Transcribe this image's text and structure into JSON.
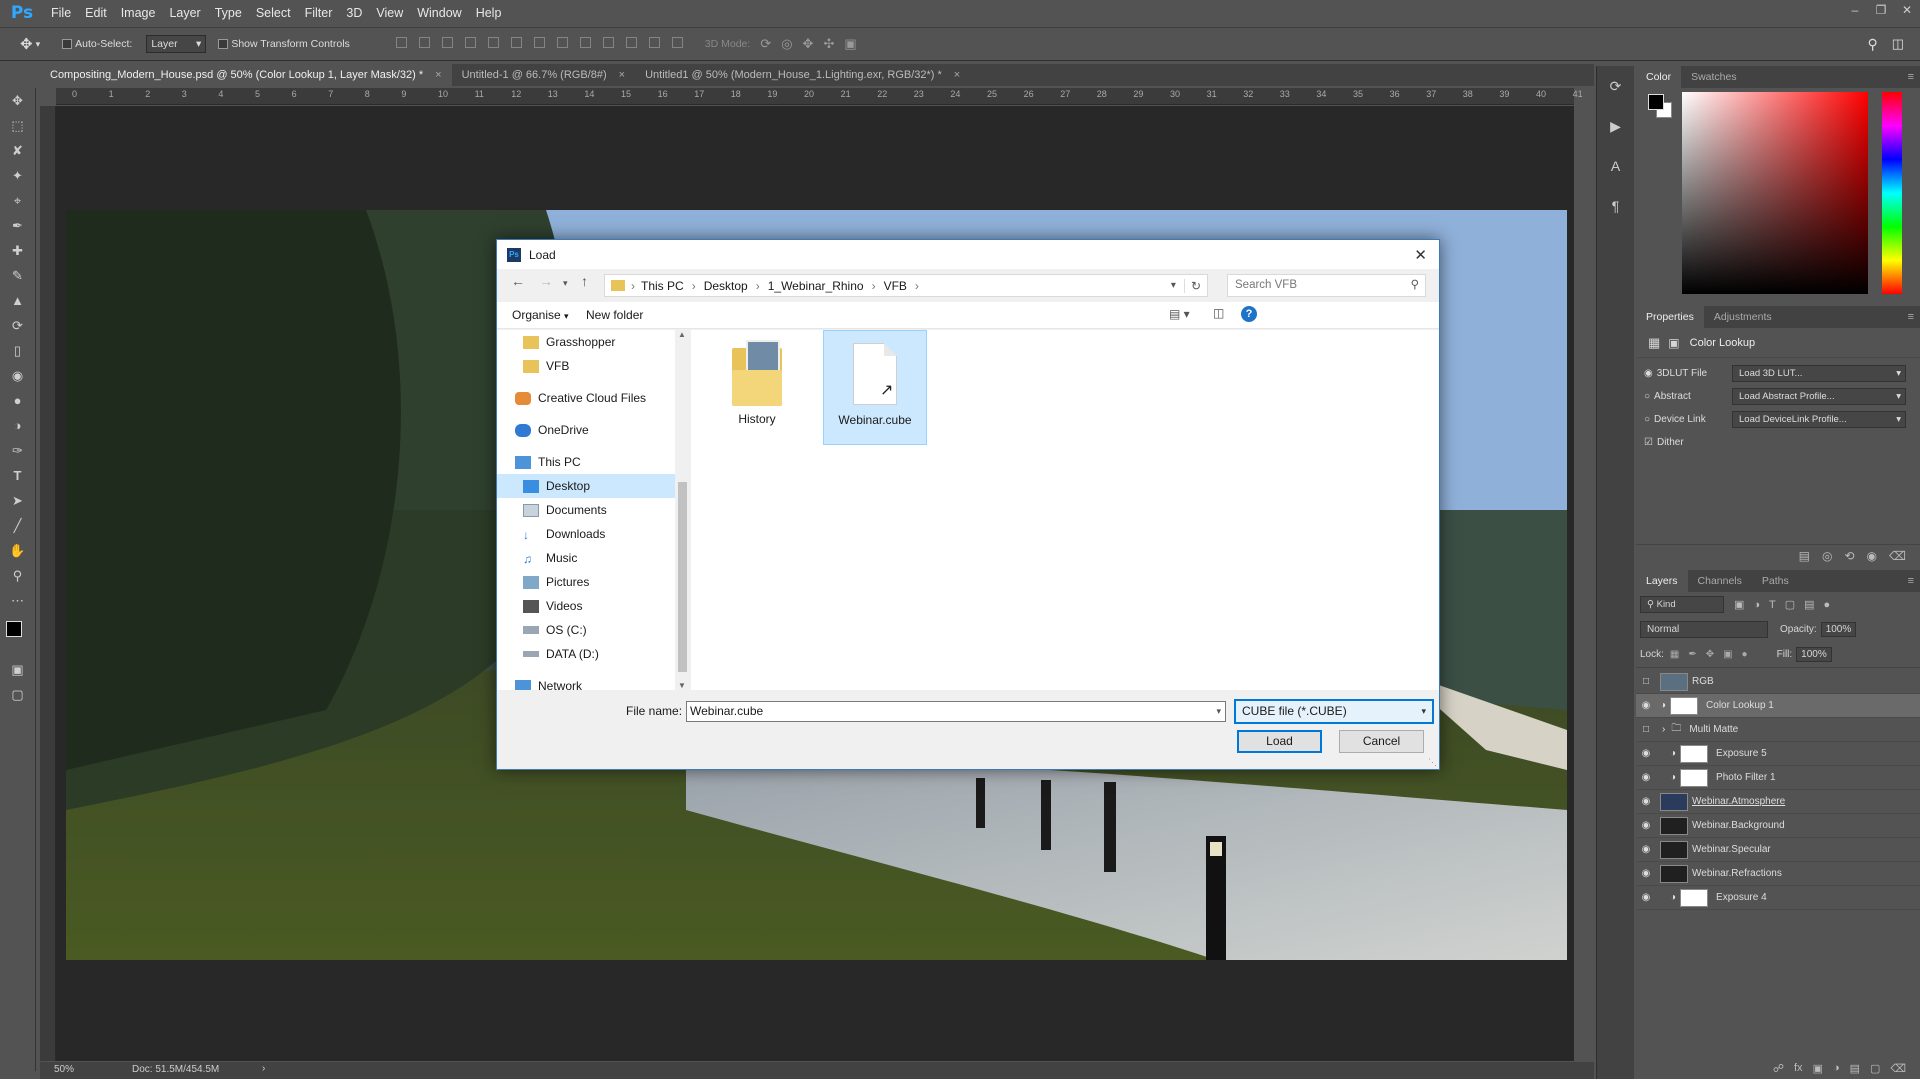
{
  "app": {
    "logo": "Ps"
  },
  "menu": [
    "File",
    "Edit",
    "Image",
    "Layer",
    "Type",
    "Select",
    "Filter",
    "3D",
    "View",
    "Window",
    "Help"
  ],
  "options": {
    "auto_select_label": "Auto-Select:",
    "auto_select_value": "Layer",
    "show_transform": "Show Transform Controls",
    "mode_3d": "3D Mode:"
  },
  "tabs": [
    {
      "label": "Compositing_Modern_House.psd @ 50% (Color Lookup 1, Layer Mask/32) *",
      "close": "×"
    },
    {
      "label": "Untitled-1 @ 66.7% (RGB/8#)",
      "close": "×"
    },
    {
      "label": "Untitled1 @ 50% (Modern_House_1.Lighting.exr, RGB/32*) *",
      "close": "×"
    }
  ],
  "ruler_ticks": [
    "0",
    "1",
    "2",
    "3",
    "4",
    "5",
    "6",
    "7",
    "8",
    "9",
    "10",
    "11",
    "12",
    "13",
    "14",
    "15",
    "16",
    "17",
    "18",
    "19",
    "20",
    "21",
    "22",
    "23",
    "24",
    "25",
    "26",
    "27",
    "28",
    "29",
    "30",
    "31",
    "32",
    "33",
    "34",
    "35",
    "36",
    "37",
    "38",
    "39",
    "40",
    "41"
  ],
  "status": {
    "zoom": "50%",
    "doc": "Doc: 51.5M/454.5M"
  },
  "dialog": {
    "title": "Load",
    "breadcrumb": [
      "This PC",
      "Desktop",
      "1_Webinar_Rhino",
      "VFB"
    ],
    "search_placeholder": "Search VFB",
    "organise": "Organise",
    "new_folder": "New folder",
    "tree": [
      {
        "label": "Grasshopper",
        "icon": "folder-icon"
      },
      {
        "label": "VFB",
        "icon": "folder-icon"
      },
      {
        "label": "Creative Cloud Files",
        "icon": "creative-cloud-icon"
      },
      {
        "label": "OneDrive",
        "icon": "cloud-icon"
      },
      {
        "label": "This PC",
        "icon": "computer-icon"
      },
      {
        "label": "Desktop",
        "icon": "desktop-icon",
        "selected": true
      },
      {
        "label": "Documents",
        "icon": "documents-icon"
      },
      {
        "label": "Downloads",
        "icon": "downloads-icon"
      },
      {
        "label": "Music",
        "icon": "music-icon"
      },
      {
        "label": "Pictures",
        "icon": "pictures-icon"
      },
      {
        "label": "Videos",
        "icon": "videos-icon"
      },
      {
        "label": "OS (C:)",
        "icon": "drive-icon"
      },
      {
        "label": "DATA (D:)",
        "icon": "drive-icon"
      },
      {
        "label": "Network",
        "icon": "network-icon"
      }
    ],
    "files": [
      {
        "name": "History",
        "type": "folder"
      },
      {
        "name": "Webinar.cube",
        "type": "file",
        "selected": true
      }
    ],
    "file_name_label": "File name:",
    "file_name_value": "Webinar.cube",
    "file_type": "CUBE file (*.CUBE)",
    "load": "Load",
    "cancel": "Cancel"
  },
  "color_panel": {
    "tabs": [
      "Color",
      "Swatches"
    ]
  },
  "properties": {
    "tabs": [
      "Properties",
      "Adjustments"
    ],
    "title": "Color Lookup",
    "rows": [
      {
        "label": "3DLUT File",
        "value": "Load 3D LUT..."
      },
      {
        "label": "Abstract",
        "value": "Load Abstract Profile..."
      },
      {
        "label": "Device Link",
        "value": "Load DeviceLink Profile..."
      }
    ],
    "dither": "Dither"
  },
  "layers_panel": {
    "tabs": [
      "Layers",
      "Channels",
      "Paths"
    ],
    "kind": "Kind",
    "blend": "Normal",
    "opacity_label": "Opacity:",
    "opacity": "100%",
    "lock_label": "Lock:",
    "fill_label": "Fill:",
    "fill": "100%",
    "layers": [
      {
        "name": "RGB",
        "visible": false,
        "kind": "image"
      },
      {
        "name": "Color Lookup 1",
        "visible": true,
        "kind": "adjustment",
        "selected": true
      },
      {
        "name": "Multi Matte",
        "visible": false,
        "kind": "group"
      },
      {
        "name": "Exposure 5",
        "visible": true,
        "kind": "adjustment"
      },
      {
        "name": "Photo Filter 1",
        "visible": true,
        "kind": "adjustment"
      },
      {
        "name": "Webinar.Atmosphere",
        "visible": true,
        "kind": "image"
      },
      {
        "name": "Webinar.Background",
        "visible": true,
        "kind": "image"
      },
      {
        "name": "Webinar.Specular",
        "visible": true,
        "kind": "image"
      },
      {
        "name": "Webinar.Refractions",
        "visible": true,
        "kind": "image"
      },
      {
        "name": "Exposure 4",
        "visible": true,
        "kind": "adjustment"
      }
    ]
  },
  "colors": {
    "accent": "#0078d7",
    "selection": "#cce8ff",
    "ps_blue": "#31a8ff"
  }
}
